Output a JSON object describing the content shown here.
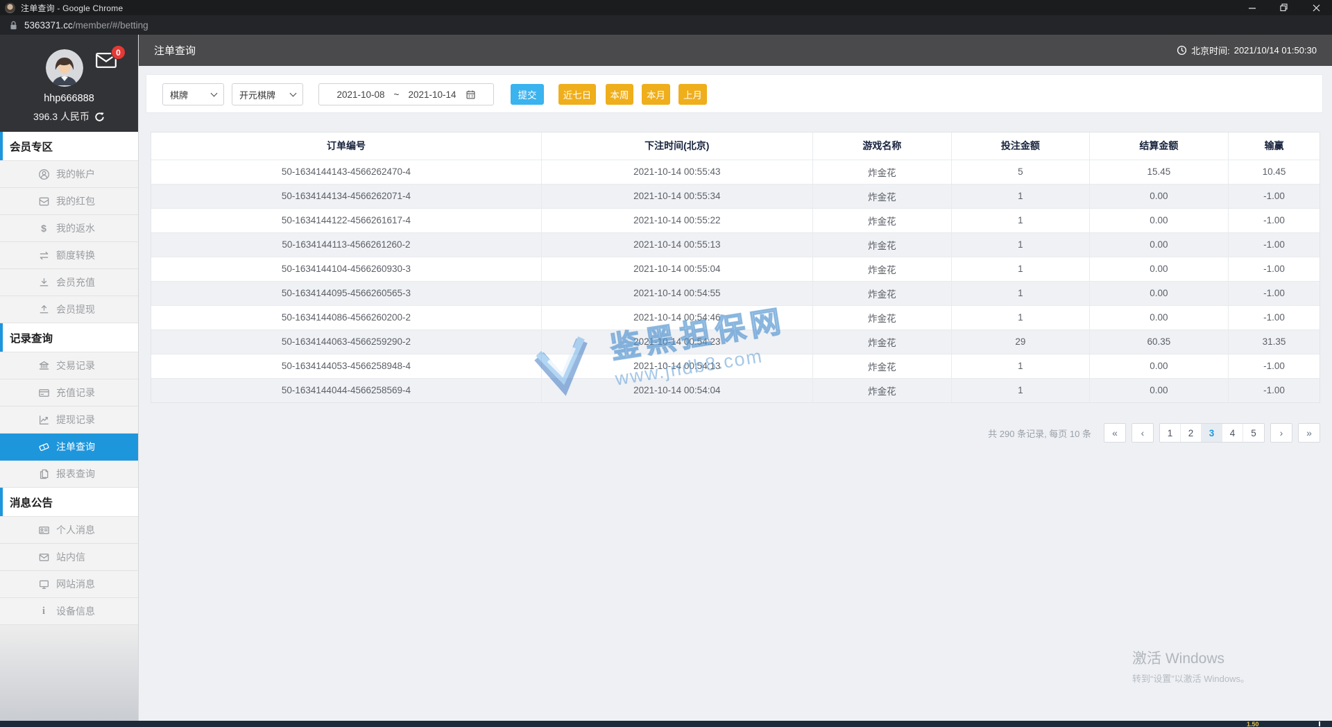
{
  "colors": {
    "accent_blue": "#1e96dc",
    "submit_blue": "#3ab3ef",
    "warning_yellow": "#efae1b",
    "watermark_blue": "#5b9bd5",
    "badge_red": "#e53935"
  },
  "window": {
    "title": "注单查询 - Google Chrome",
    "url_domain": "5363371.cc",
    "url_path": "/member/#/betting"
  },
  "header": {
    "title": "注单查询",
    "time_label": "北京时间:",
    "time_value": "2021/10/14 01:50:30"
  },
  "user": {
    "name": "hhp666888",
    "balance": "396.3 人民币",
    "mail_badge": "0"
  },
  "sidebar": {
    "sections": [
      {
        "title": "会员专区",
        "items": [
          {
            "id": "account",
            "icon": "user-icon",
            "label": "我的帐户"
          },
          {
            "id": "redpacket",
            "icon": "redpacket-icon",
            "label": "我的红包"
          },
          {
            "id": "rebate",
            "icon": "dollar-icon",
            "label": "我的返水"
          },
          {
            "id": "transfer",
            "icon": "transfer-icon",
            "label": "额度转换"
          },
          {
            "id": "deposit",
            "icon": "deposit-icon",
            "label": "会员充值"
          },
          {
            "id": "withdraw",
            "icon": "withdraw-icon",
            "label": "会员提现"
          }
        ]
      },
      {
        "title": "记录查询",
        "items": [
          {
            "id": "transactions",
            "icon": "bank-icon",
            "label": "交易记录"
          },
          {
            "id": "recharge-record",
            "icon": "card-icon",
            "label": "充值记录"
          },
          {
            "id": "withdraw-record",
            "icon": "chart-icon",
            "label": "提现记录"
          },
          {
            "id": "betting-query",
            "icon": "ticket-icon",
            "label": "注单查询",
            "active": true
          },
          {
            "id": "report-query",
            "icon": "report-icon",
            "label": "报表查询"
          }
        ]
      },
      {
        "title": "消息公告",
        "items": [
          {
            "id": "personal-message",
            "icon": "idcard-icon",
            "label": "个人消息"
          },
          {
            "id": "site-mail",
            "icon": "mail-icon",
            "label": "站内信"
          },
          {
            "id": "site-message",
            "icon": "monitor-icon",
            "label": "网站消息"
          },
          {
            "id": "device-info",
            "icon": "info-icon",
            "label": "设备信息"
          }
        ]
      }
    ]
  },
  "filters": {
    "category": "棋牌",
    "provider": "开元棋牌",
    "date_from": "2021-10-08",
    "date_separator": "~",
    "date_to": "2021-10-14",
    "submit": "提交",
    "quick": [
      {
        "id": "last7",
        "label": "近七日"
      },
      {
        "id": "this-week",
        "label": "本周"
      },
      {
        "id": "this-month",
        "label": "本月"
      },
      {
        "id": "last-month",
        "label": "上月"
      }
    ]
  },
  "table": {
    "columns": [
      "订单编号",
      "下注时间(北京)",
      "游戏名称",
      "投注金额",
      "结算金额",
      "输赢"
    ],
    "column_ids": [
      "order-no",
      "bet-time",
      "game-name",
      "bet-amount",
      "settle-amount",
      "win-loss"
    ],
    "rows": [
      [
        "50-1634144143-4566262470-4",
        "2021-10-14 00:55:43",
        "炸金花",
        "5",
        "15.45",
        "10.45"
      ],
      [
        "50-1634144134-4566262071-4",
        "2021-10-14 00:55:34",
        "炸金花",
        "1",
        "0.00",
        "-1.00"
      ],
      [
        "50-1634144122-4566261617-4",
        "2021-10-14 00:55:22",
        "炸金花",
        "1",
        "0.00",
        "-1.00"
      ],
      [
        "50-1634144113-4566261260-2",
        "2021-10-14 00:55:13",
        "炸金花",
        "1",
        "0.00",
        "-1.00"
      ],
      [
        "50-1634144104-4566260930-3",
        "2021-10-14 00:55:04",
        "炸金花",
        "1",
        "0.00",
        "-1.00"
      ],
      [
        "50-1634144095-4566260565-3",
        "2021-10-14 00:54:55",
        "炸金花",
        "1",
        "0.00",
        "-1.00"
      ],
      [
        "50-1634144086-4566260200-2",
        "2021-10-14 00:54:46",
        "炸金花",
        "1",
        "0.00",
        "-1.00"
      ],
      [
        "50-1634144063-4566259290-2",
        "2021-10-14 00:54:23",
        "炸金花",
        "29",
        "60.35",
        "31.35"
      ],
      [
        "50-1634144053-4566258948-4",
        "2021-10-14 00:54:13",
        "炸金花",
        "1",
        "0.00",
        "-1.00"
      ],
      [
        "50-1634144044-4566258569-4",
        "2021-10-14 00:54:04",
        "炸金花",
        "1",
        "0.00",
        "-1.00"
      ]
    ]
  },
  "pagination": {
    "summary": "共 290 条记录, 每页 10 条",
    "first": "«",
    "prev": "‹",
    "next": "›",
    "last": "»",
    "pages": [
      "1",
      "2",
      "3",
      "4",
      "5"
    ],
    "active": "3"
  },
  "watermark": {
    "line1": "鉴黑担保网",
    "line2": "www.jndb8.com"
  },
  "windows_activation": {
    "line1": "激活 Windows",
    "line2": "转到“设置”以激活 Windows。"
  },
  "bottom_bar": {
    "text": "1.50"
  }
}
